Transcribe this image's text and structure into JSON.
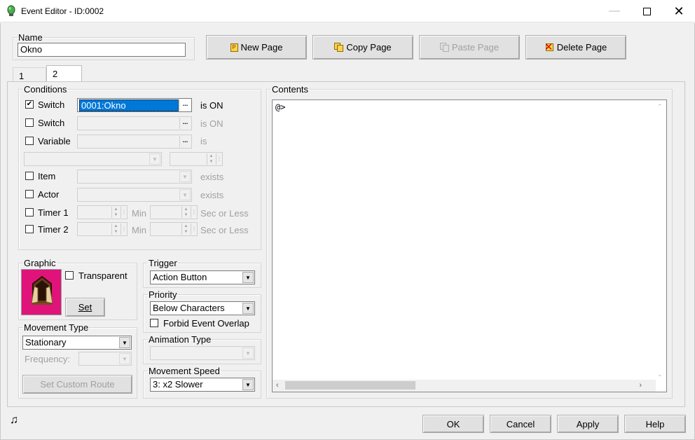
{
  "window": {
    "title": "Event Editor - ID:0002",
    "minimize_icon": "minimize-icon",
    "maximize_icon": "maximize-icon",
    "close_icon": "close-icon"
  },
  "name": {
    "label": "Name",
    "value": "Okno"
  },
  "page_buttons": {
    "new": "New Page",
    "copy": "Copy Page",
    "paste": "Paste Page",
    "delete": "Delete Page"
  },
  "tabs": [
    {
      "label": "1"
    },
    {
      "label": "2"
    }
  ],
  "conditions": {
    "legend": "Conditions",
    "switch1": {
      "label": "Switch",
      "checked": true,
      "value": "0001:Okno",
      "suffix": "is ON"
    },
    "switch2": {
      "label": "Switch",
      "checked": false,
      "value": "",
      "suffix": "is ON"
    },
    "variable": {
      "label": "Variable",
      "checked": false,
      "value": "",
      "suffix": "is"
    },
    "item": {
      "label": "Item",
      "checked": false,
      "suffix": "exists"
    },
    "actor": {
      "label": "Actor",
      "checked": false,
      "suffix": "exists"
    },
    "timer1": {
      "label": "Timer 1",
      "checked": false,
      "min_label": "Min",
      "sec_label": "Sec or Less"
    },
    "timer2": {
      "label": "Timer 2",
      "checked": false,
      "min_label": "Min",
      "sec_label": "Sec or Less"
    }
  },
  "graphic": {
    "legend": "Graphic",
    "transparent_label": "Transparent",
    "set_button": "Set"
  },
  "trigger": {
    "legend": "Trigger",
    "value": "Action Button"
  },
  "priority": {
    "legend": "Priority",
    "value": "Below Characters",
    "forbid_overlap_label": "Forbid Event Overlap"
  },
  "animation_type": {
    "legend": "Animation Type",
    "value": ""
  },
  "movement_speed": {
    "legend": "Movement Speed",
    "value": "3: x2 Slower"
  },
  "movement_type": {
    "legend": "Movement Type",
    "value": "Stationary",
    "frequency_label": "Frequency:",
    "custom_route_button": "Set Custom Route"
  },
  "contents": {
    "legend": "Contents",
    "lines": [
      "@>"
    ]
  },
  "footer": {
    "ok": "OK",
    "cancel": "Cancel",
    "apply": "Apply",
    "help": "Help",
    "music_icon": "music-note-icon"
  },
  "colors": {
    "sprite_bg": "#e0137a",
    "selection": "#0078d7"
  }
}
